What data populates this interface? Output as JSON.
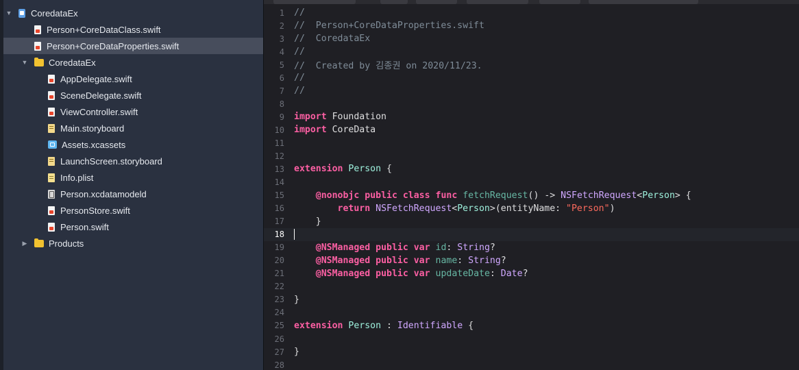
{
  "navigator": {
    "items": [
      {
        "label": "CoredataEx",
        "icon": "project-icon",
        "level": 0,
        "disclosure": "▼",
        "selected": false
      },
      {
        "label": "Person+CoreDataClass.swift",
        "icon": "swift-file-icon",
        "level": 1,
        "disclosure": "",
        "selected": false
      },
      {
        "label": "Person+CoreDataProperties.swift",
        "icon": "swift-file-icon",
        "level": 1,
        "disclosure": "",
        "selected": true
      },
      {
        "label": "CoredataEx",
        "icon": "folder-icon",
        "level": 1,
        "disclosure": "▼",
        "selected": false
      },
      {
        "label": "AppDelegate.swift",
        "icon": "swift-file-icon",
        "level": 2,
        "disclosure": "",
        "selected": false
      },
      {
        "label": "SceneDelegate.swift",
        "icon": "swift-file-icon",
        "level": 2,
        "disclosure": "",
        "selected": false
      },
      {
        "label": "ViewController.swift",
        "icon": "swift-file-icon",
        "level": 2,
        "disclosure": "",
        "selected": false
      },
      {
        "label": "Main.storyboard",
        "icon": "storyboard-icon",
        "level": 2,
        "disclosure": "",
        "selected": false
      },
      {
        "label": "Assets.xcassets",
        "icon": "assets-icon",
        "level": 2,
        "disclosure": "",
        "selected": false
      },
      {
        "label": "LaunchScreen.storyboard",
        "icon": "storyboard-icon",
        "level": 2,
        "disclosure": "",
        "selected": false
      },
      {
        "label": "Info.plist",
        "icon": "plist-icon",
        "level": 2,
        "disclosure": "",
        "selected": false
      },
      {
        "label": "Person.xcdatamodeld",
        "icon": "datamodel-icon",
        "level": 2,
        "disclosure": "",
        "selected": false
      },
      {
        "label": "PersonStore.swift",
        "icon": "swift-file-icon",
        "level": 2,
        "disclosure": "",
        "selected": false
      },
      {
        "label": "Person.swift",
        "icon": "swift-file-icon",
        "level": 2,
        "disclosure": "",
        "selected": false
      },
      {
        "label": "Products",
        "icon": "folder-icon",
        "level": 1,
        "disclosure": "▶",
        "selected": false
      }
    ]
  },
  "editor": {
    "current_line": 18,
    "lines": [
      {
        "n": "1",
        "tokens": [
          [
            "c",
            "//"
          ]
        ]
      },
      {
        "n": "2",
        "tokens": [
          [
            "c",
            "//  Person+CoreDataProperties.swift"
          ]
        ]
      },
      {
        "n": "3",
        "tokens": [
          [
            "c",
            "//  CoredataEx"
          ]
        ]
      },
      {
        "n": "4",
        "tokens": [
          [
            "c",
            "//"
          ]
        ]
      },
      {
        "n": "5",
        "tokens": [
          [
            "c",
            "//  Created by 김종권 on 2020/11/23."
          ]
        ]
      },
      {
        "n": "6",
        "tokens": [
          [
            "c",
            "//"
          ]
        ]
      },
      {
        "n": "7",
        "tokens": [
          [
            "c",
            "//"
          ]
        ]
      },
      {
        "n": "8",
        "tokens": []
      },
      {
        "n": "9",
        "tokens": [
          [
            "k",
            "import"
          ],
          [
            "p",
            " Foundation"
          ]
        ]
      },
      {
        "n": "10",
        "tokens": [
          [
            "k",
            "import"
          ],
          [
            "p",
            " CoreData"
          ]
        ]
      },
      {
        "n": "11",
        "tokens": []
      },
      {
        "n": "12",
        "tokens": []
      },
      {
        "n": "13",
        "tokens": [
          [
            "k",
            "extension"
          ],
          [
            "p",
            " "
          ],
          [
            "pt",
            "Person"
          ],
          [
            "p",
            " {"
          ]
        ]
      },
      {
        "n": "14",
        "tokens": []
      },
      {
        "n": "15",
        "tokens": [
          [
            "p",
            "    "
          ],
          [
            "k",
            "@nonobjc"
          ],
          [
            "p",
            " "
          ],
          [
            "k",
            "public"
          ],
          [
            "p",
            " "
          ],
          [
            "k",
            "class"
          ],
          [
            "p",
            " "
          ],
          [
            "k",
            "func"
          ],
          [
            "p",
            " "
          ],
          [
            "f",
            "fetchRequest"
          ],
          [
            "p",
            "() -> "
          ],
          [
            "t",
            "NSFetchRequest"
          ],
          [
            "p",
            "<"
          ],
          [
            "pt",
            "Person"
          ],
          [
            "p",
            "> {"
          ]
        ]
      },
      {
        "n": "16",
        "tokens": [
          [
            "p",
            "        "
          ],
          [
            "k",
            "return"
          ],
          [
            "p",
            " "
          ],
          [
            "t",
            "NSFetchRequest"
          ],
          [
            "p",
            "<"
          ],
          [
            "pt",
            "Person"
          ],
          [
            "p",
            ">(entityName: "
          ],
          [
            "s",
            "\"Person\""
          ],
          [
            "p",
            ")"
          ]
        ]
      },
      {
        "n": "17",
        "tokens": [
          [
            "p",
            "    }"
          ]
        ]
      },
      {
        "n": "18",
        "tokens": []
      },
      {
        "n": "19",
        "tokens": [
          [
            "p",
            "    "
          ],
          [
            "k",
            "@NSManaged"
          ],
          [
            "p",
            " "
          ],
          [
            "k",
            "public"
          ],
          [
            "p",
            " "
          ],
          [
            "k",
            "var"
          ],
          [
            "p",
            " "
          ],
          [
            "f",
            "id"
          ],
          [
            "p",
            ": "
          ],
          [
            "t",
            "String"
          ],
          [
            "p",
            "?"
          ]
        ]
      },
      {
        "n": "20",
        "tokens": [
          [
            "p",
            "    "
          ],
          [
            "k",
            "@NSManaged"
          ],
          [
            "p",
            " "
          ],
          [
            "k",
            "public"
          ],
          [
            "p",
            " "
          ],
          [
            "k",
            "var"
          ],
          [
            "p",
            " "
          ],
          [
            "f",
            "name"
          ],
          [
            "p",
            ": "
          ],
          [
            "t",
            "String"
          ],
          [
            "p",
            "?"
          ]
        ]
      },
      {
        "n": "21",
        "tokens": [
          [
            "p",
            "    "
          ],
          [
            "k",
            "@NSManaged"
          ],
          [
            "p",
            " "
          ],
          [
            "k",
            "public"
          ],
          [
            "p",
            " "
          ],
          [
            "k",
            "var"
          ],
          [
            "p",
            " "
          ],
          [
            "f",
            "updateDate"
          ],
          [
            "p",
            ": "
          ],
          [
            "t",
            "Date"
          ],
          [
            "p",
            "?"
          ]
        ]
      },
      {
        "n": "22",
        "tokens": []
      },
      {
        "n": "23",
        "tokens": [
          [
            "p",
            "}"
          ]
        ]
      },
      {
        "n": "24",
        "tokens": []
      },
      {
        "n": "25",
        "tokens": [
          [
            "k",
            "extension"
          ],
          [
            "p",
            " "
          ],
          [
            "pt",
            "Person"
          ],
          [
            "p",
            " : "
          ],
          [
            "t",
            "Identifiable"
          ],
          [
            "p",
            " {"
          ]
        ]
      },
      {
        "n": "26",
        "tokens": []
      },
      {
        "n": "27",
        "tokens": [
          [
            "p",
            "}"
          ]
        ]
      },
      {
        "n": "28",
        "tokens": []
      }
    ]
  }
}
